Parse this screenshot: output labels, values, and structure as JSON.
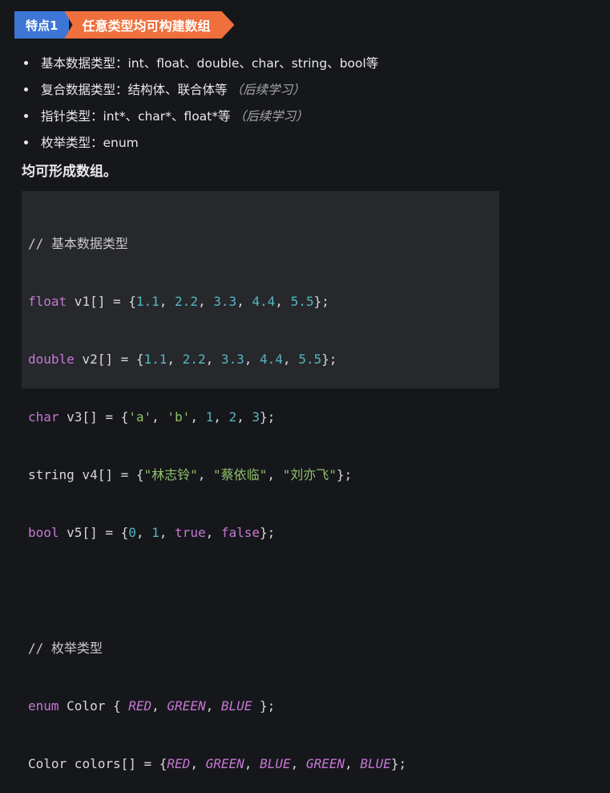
{
  "header": {
    "tag": "特点1",
    "title": "任意类型均可构建数组"
  },
  "bullets": [
    {
      "text": "基本数据类型：int、float、double、char、string、bool等",
      "note": ""
    },
    {
      "text": "复合数据类型：结构体、联合体等",
      "note": "（后续学习）"
    },
    {
      "text": "指针类型：int*、char*、float*等",
      "note": "（后续学习）"
    },
    {
      "text": "枚举类型：enum",
      "note": ""
    }
  ],
  "summary": "均可形成数组。",
  "code": {
    "comment1": "// 基本数据类型",
    "l1": {
      "type": "float",
      "decl": " v1[] = {",
      "vals": [
        "1.1",
        "2.2",
        "3.3",
        "4.4",
        "5.5"
      ],
      "end": "};"
    },
    "l2": {
      "type": "double",
      "decl": " v2[] = {",
      "vals": [
        "1.1",
        "2.2",
        "3.3",
        "4.4",
        "5.5"
      ],
      "end": "};"
    },
    "l3": {
      "type": "char",
      "decl": " v3[] = {",
      "vals": [
        "'a'",
        "'b'",
        "1",
        "2",
        "3"
      ],
      "end": "};"
    },
    "l4": {
      "type": "string",
      "decl": " v4[] = {",
      "vals": [
        "\"林志铃\"",
        "\"蔡依临\"",
        "\"刘亦飞\""
      ],
      "end": "};"
    },
    "l5": {
      "type": "bool",
      "decl": " v5[] = {",
      "vals": [
        "0",
        "1",
        "true",
        "false"
      ],
      "end": "};"
    },
    "comment2": "// 枚举类型",
    "l6": {
      "type": "enum",
      "decl": " Color { ",
      "vals": [
        "RED",
        "GREEN",
        "BLUE"
      ],
      "end": " };"
    },
    "l7": {
      "type": "Color",
      "decl": " colors[] = {",
      "vals": [
        "RED",
        "GREEN",
        "BLUE",
        "GREEN",
        "BLUE"
      ],
      "end": "};"
    }
  }
}
